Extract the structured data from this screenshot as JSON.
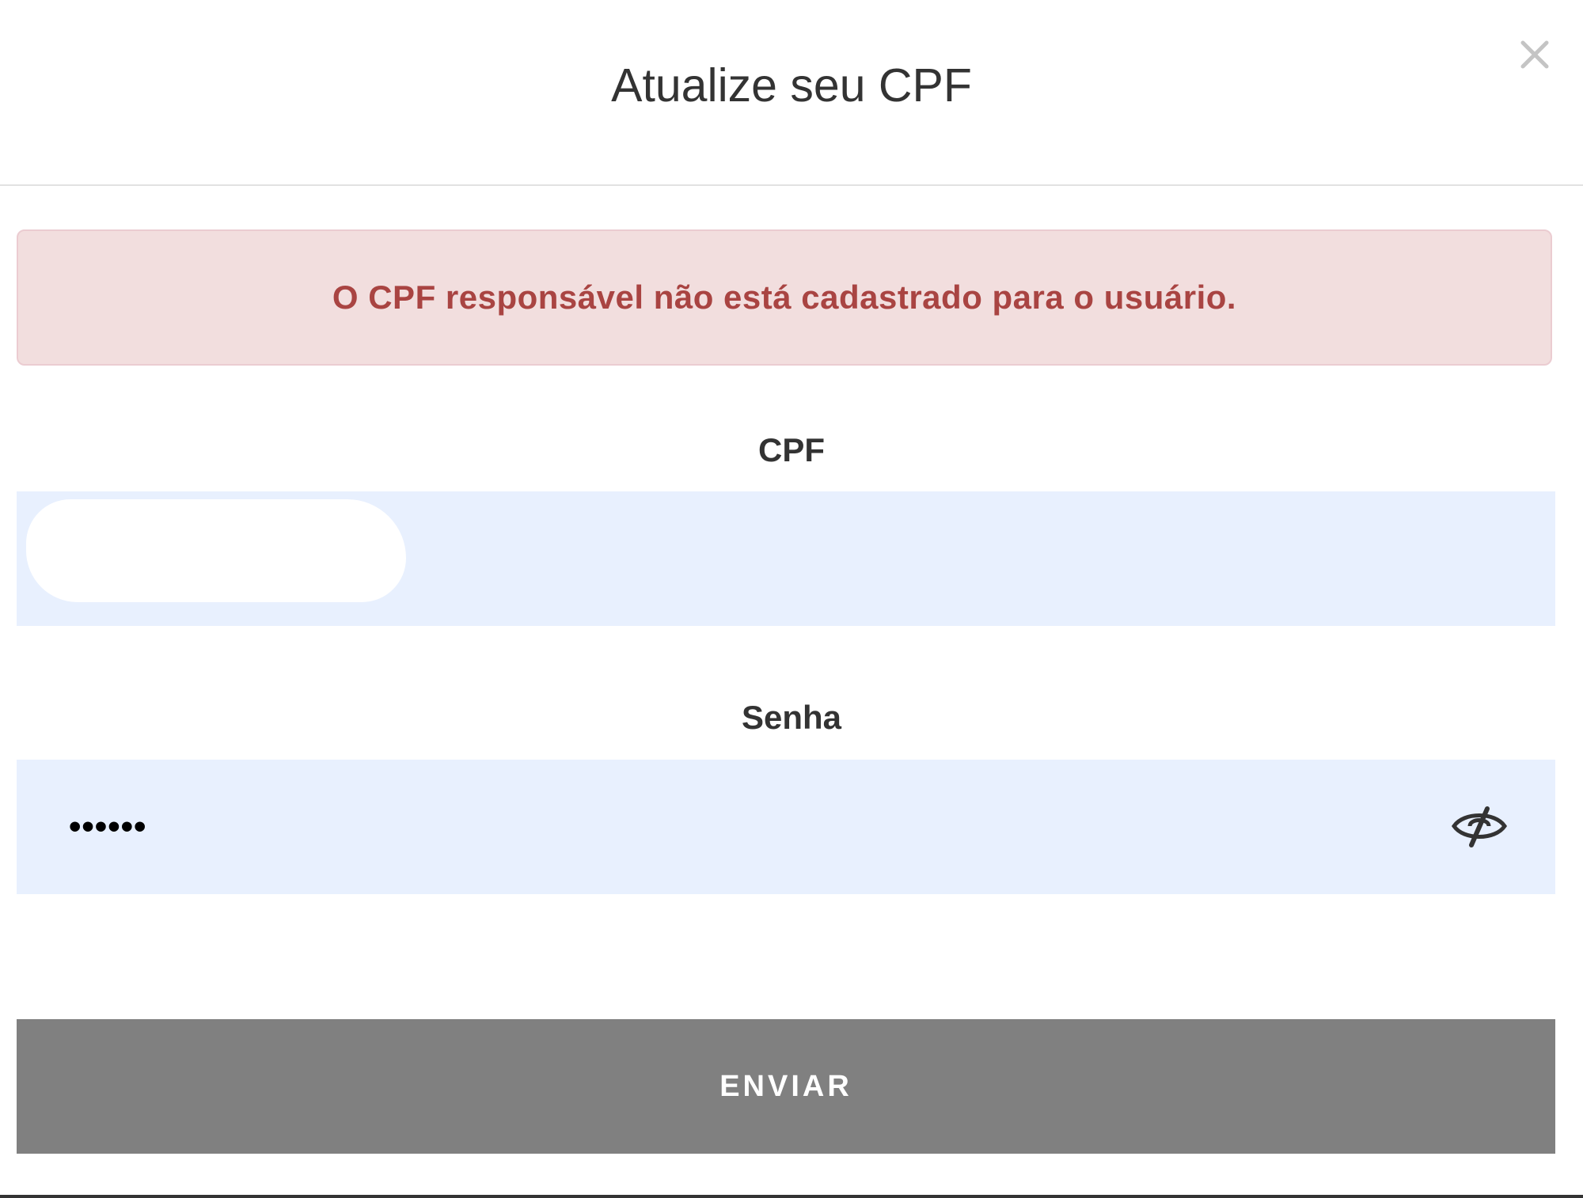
{
  "modal": {
    "title": "Atualize seu CPF",
    "close_icon": "close-icon"
  },
  "alert": {
    "message": "O CPF responsável não está cadastrado para o usuário.",
    "background_color": "#f2dede",
    "text_color": "#a94442"
  },
  "form": {
    "cpf": {
      "label": "CPF",
      "value": ""
    },
    "password": {
      "label": "Senha",
      "masked_value": "••••••",
      "toggle_icon": "eye-slash-icon"
    },
    "submit_label": "ENVIAR"
  },
  "colors": {
    "input_background": "#e8f0fe",
    "button_background": "#808080",
    "button_text": "#ffffff"
  }
}
